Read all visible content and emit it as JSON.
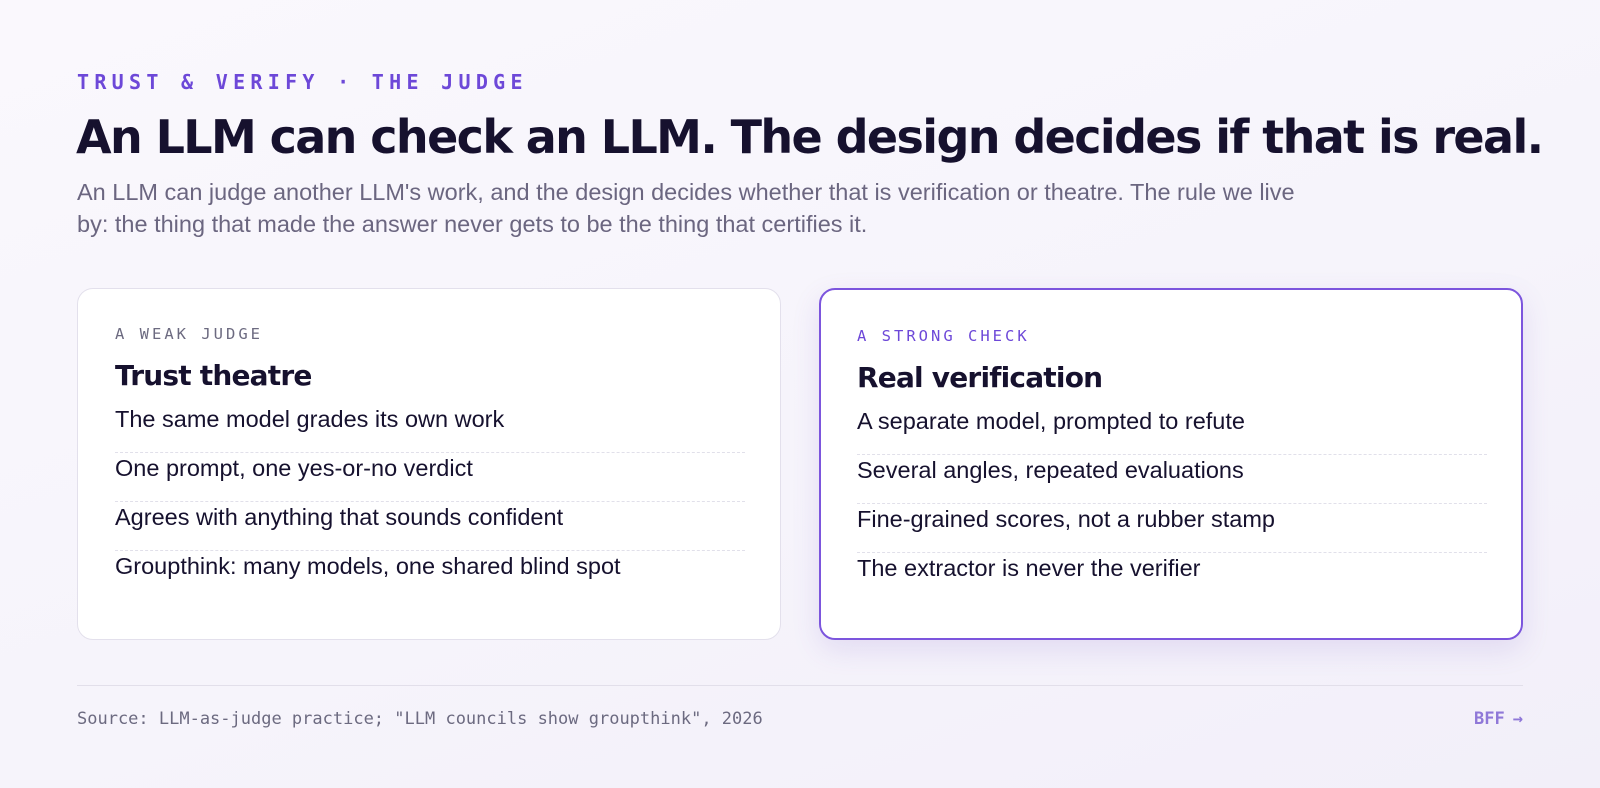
{
  "header": {
    "eyebrow": "TRUST & VERIFY · THE JUDGE",
    "title": "An LLM can check an LLM. The design decides if that is real.",
    "lede": "An LLM can judge another LLM's work, and the design decides whether that is verification or theatre. The rule we live by: the thing that made the answer never gets to be the thing that certifies it."
  },
  "cards": [
    {
      "kicker": "A WEAK JUDGE",
      "title": "Trust theatre",
      "items": [
        "The same model grades its own work",
        "One prompt, one yes-or-no verdict",
        "Agrees with anything that sounds confident",
        "Groupthink: many models, one shared blind spot"
      ]
    },
    {
      "kicker": "A STRONG CHECK",
      "title": "Real verification",
      "items": [
        "A separate model, prompted to refute",
        "Several angles, repeated evaluations",
        "Fine-grained scores, not a rubber stamp",
        "The extractor is never the verifier"
      ]
    }
  ],
  "footer": {
    "source": "Source: LLM-as-judge practice; \"LLM councils show groupthink\", 2026",
    "mark": "BFF",
    "mark_arrow": "→"
  },
  "colors": {
    "accent": "#6d48d8",
    "ink": "#16112e",
    "muted": "#6b6680",
    "strong_border": "#7c55dd"
  }
}
